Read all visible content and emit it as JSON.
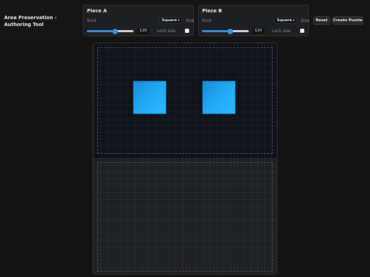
{
  "app": {
    "title": "Area Preservation - Authoring Tool"
  },
  "pieces": [
    {
      "title": "Piece A",
      "kind_label": "Kind",
      "kind_value": "Square",
      "size_label": "Size",
      "size": 120,
      "size_max": 200,
      "lock_label": "Lock size",
      "locked": false
    },
    {
      "title": "Piece B",
      "kind_label": "Kind",
      "kind_value": "Square",
      "size_label": "Size",
      "size": 120,
      "size_max": 200,
      "lock_label": "Lock size",
      "locked": false
    }
  ],
  "toolbar": {
    "reset_label": "Reset",
    "create_label": "Create Puzzle"
  },
  "colors": {
    "accent": "#3d8fe0",
    "piece_fill": "#22adf6",
    "background": "#141414"
  },
  "icons": {
    "dropdown": "chevron-down-icon"
  }
}
